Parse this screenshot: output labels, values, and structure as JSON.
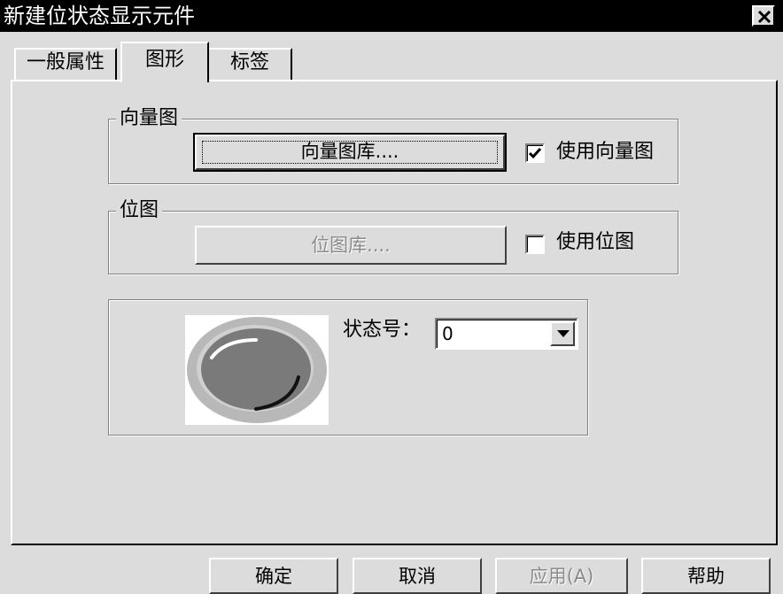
{
  "window": {
    "title": "新建位状态显示元件",
    "close_icon": "close-x-icon"
  },
  "tabs": [
    {
      "label": "一般属性"
    },
    {
      "label": "图形",
      "selected": true
    },
    {
      "label": "标签"
    }
  ],
  "vector_group": {
    "legend": "向量图",
    "library_button": "向量图库....",
    "use_checkbox_label": "使用向量图",
    "use_checked": true
  },
  "bitmap_group": {
    "legend": "位图",
    "library_button": "位图库....",
    "use_checkbox_label": "使用位图",
    "use_checked": false
  },
  "preview": {
    "state_label": "状态号：",
    "state_value": "0",
    "preview_icon": "round-button-preview-icon",
    "dropdown_icon": "dropdown-arrow-icon"
  },
  "footer": {
    "ok": "确定",
    "cancel": "取消",
    "apply": "应用(A)",
    "help": "帮助"
  },
  "colors": {
    "titlebar": "#000000",
    "dialog_bg": "#dcdcdc",
    "disabled_text": "#8a8a8a"
  }
}
